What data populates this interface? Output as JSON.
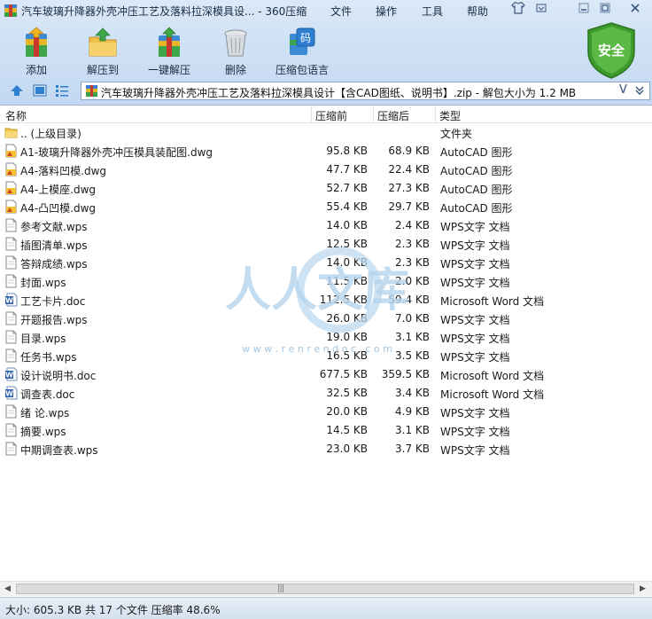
{
  "window": {
    "title": "汽车玻璃升降器外壳冲压工艺及落料拉深模具设... - 360压缩",
    "menus": [
      "文件",
      "操作",
      "工具",
      "帮助"
    ]
  },
  "toolbar": {
    "add": "添加",
    "extract_to": "解压到",
    "one_click_extract": "一键解压",
    "delete": "删除",
    "archive_lang": "压缩包语言",
    "security": "安全"
  },
  "address": {
    "path": "汽车玻璃升降器外壳冲压工艺及落料拉深模具设计【含CAD图纸、说明书】.zip - 解包大小为 1.2 MB"
  },
  "columns": {
    "name": "名称",
    "size": "压缩前",
    "compressed": "压缩后",
    "type": "类型"
  },
  "files": [
    {
      "name": ".. (上级目录)",
      "size": "",
      "compressed": "",
      "type": "文件夹",
      "icon": "folder-icon"
    },
    {
      "name": "A1-玻璃升降器外壳冲压模具装配图.dwg",
      "size": "95.8 KB",
      "compressed": "68.9 KB",
      "type": "AutoCAD 图形",
      "icon": "dwg-file-icon"
    },
    {
      "name": "A4-落料凹模.dwg",
      "size": "47.7 KB",
      "compressed": "22.4 KB",
      "type": "AutoCAD 图形",
      "icon": "dwg-file-icon"
    },
    {
      "name": "A4-上模座.dwg",
      "size": "52.7 KB",
      "compressed": "27.3 KB",
      "type": "AutoCAD 图形",
      "icon": "dwg-file-icon"
    },
    {
      "name": "A4-凸凹模.dwg",
      "size": "55.4 KB",
      "compressed": "29.7 KB",
      "type": "AutoCAD 图形",
      "icon": "dwg-file-icon"
    },
    {
      "name": "参考文献.wps",
      "size": "14.0 KB",
      "compressed": "2.4 KB",
      "type": "WPS文字 文档",
      "icon": "wps-file-icon"
    },
    {
      "name": "插图清单.wps",
      "size": "12.5 KB",
      "compressed": "2.3 KB",
      "type": "WPS文字 文档",
      "icon": "wps-file-icon"
    },
    {
      "name": "答辩成绩.wps",
      "size": "14.0 KB",
      "compressed": "2.3 KB",
      "type": "WPS文字 文档",
      "icon": "wps-file-icon"
    },
    {
      "name": "封面.wps",
      "size": "11.5 KB",
      "compressed": "2.0 KB",
      "type": "WPS文字 文档",
      "icon": "wps-file-icon"
    },
    {
      "name": "工艺卡片.doc",
      "size": "112.5 KB",
      "compressed": "59.4 KB",
      "type": "Microsoft Word 文档",
      "icon": "word-file-icon"
    },
    {
      "name": "开题报告.wps",
      "size": "26.0 KB",
      "compressed": "7.0 KB",
      "type": "WPS文字 文档",
      "icon": "wps-file-icon"
    },
    {
      "name": "目录.wps",
      "size": "19.0 KB",
      "compressed": "3.1 KB",
      "type": "WPS文字 文档",
      "icon": "wps-file-icon"
    },
    {
      "name": "任务书.wps",
      "size": "16.5 KB",
      "compressed": "3.5 KB",
      "type": "WPS文字 文档",
      "icon": "wps-file-icon"
    },
    {
      "name": "设计说明书.doc",
      "size": "677.5 KB",
      "compressed": "359.5 KB",
      "type": "Microsoft Word 文档",
      "icon": "word-file-icon"
    },
    {
      "name": "调查表.doc",
      "size": "32.5 KB",
      "compressed": "3.4 KB",
      "type": "Microsoft Word 文档",
      "icon": "word-file-icon"
    },
    {
      "name": "绪      论.wps",
      "size": "20.0 KB",
      "compressed": "4.9 KB",
      "type": "WPS文字 文档",
      "icon": "wps-file-icon"
    },
    {
      "name": "摘要.wps",
      "size": "14.5 KB",
      "compressed": "3.1 KB",
      "type": "WPS文字 文档",
      "icon": "wps-file-icon"
    },
    {
      "name": "中期调查表.wps",
      "size": "23.0 KB",
      "compressed": "3.7 KB",
      "type": "WPS文字 文档",
      "icon": "wps-file-icon"
    }
  ],
  "watermark": {
    "text": "人人文库",
    "url": "w w w . r e n r e n d o c . c o m"
  },
  "status": {
    "text": "大小: 605.3 KB 共 17 个文件 压缩率 48.6%"
  },
  "colors": {
    "chrome": "#cfe1f5",
    "shield": "#3f9a2e",
    "watermark": "#b9d6ee"
  }
}
